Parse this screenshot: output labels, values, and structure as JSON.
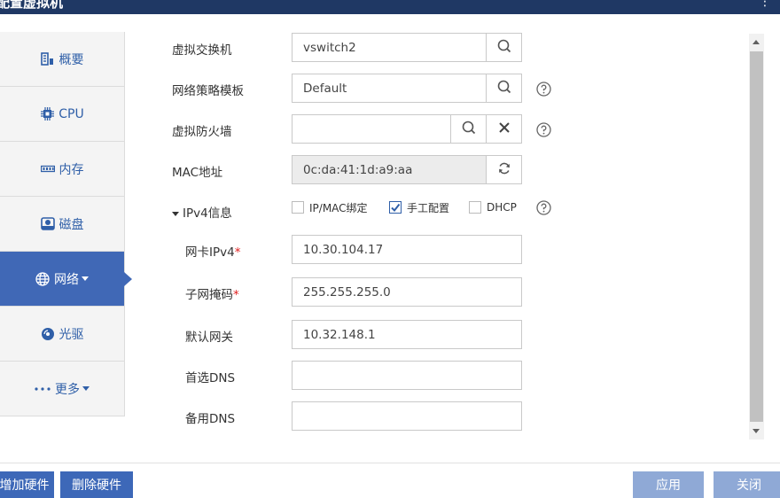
{
  "window": {
    "title": "配置虚拟机"
  },
  "sidebar": {
    "items": [
      {
        "label": "概要",
        "icon": "summary-icon"
      },
      {
        "label": "CPU",
        "icon": "cpu-icon"
      },
      {
        "label": "内存",
        "icon": "memory-icon"
      },
      {
        "label": "磁盘",
        "icon": "disk-icon"
      },
      {
        "label": "网络",
        "icon": "globe-icon",
        "active": true
      },
      {
        "label": "光驱",
        "icon": "cdrom-icon"
      },
      {
        "label": "更多",
        "icon": "more-icon"
      }
    ]
  },
  "form": {
    "vswitch": {
      "label": "虚拟交换机",
      "value": "vswitch2"
    },
    "policy": {
      "label": "网络策略模板",
      "value": "Default"
    },
    "firewall": {
      "label": "虚拟防火墙",
      "value": ""
    },
    "mac": {
      "label": "MAC地址",
      "value": "0c:da:41:1d:a9:aa"
    },
    "ipv4_section": {
      "label": "IPv4信息",
      "options": [
        {
          "label": "IP/MAC绑定",
          "checked": false
        },
        {
          "label": "手工配置",
          "checked": true
        },
        {
          "label": "DHCP",
          "checked": false
        }
      ]
    },
    "ip": {
      "label": "网卡IPv4",
      "required": "*",
      "value": "10.30.104.17"
    },
    "mask": {
      "label": "子网掩码",
      "required": "*",
      "value": "255.255.255.0"
    },
    "gateway": {
      "label": "默认网关",
      "value": "10.32.148.1"
    },
    "dns1": {
      "label": "首选DNS",
      "value": ""
    },
    "dns2": {
      "label": "备用DNS",
      "value": ""
    }
  },
  "footer": {
    "add_hw": "增加硬件",
    "remove_hw": "删除硬件",
    "apply": "应用",
    "close": "关闭"
  },
  "colors": {
    "accent": "#4068b6",
    "titlebar": "#1f3864",
    "button_disabled": "#8fa9d6"
  }
}
